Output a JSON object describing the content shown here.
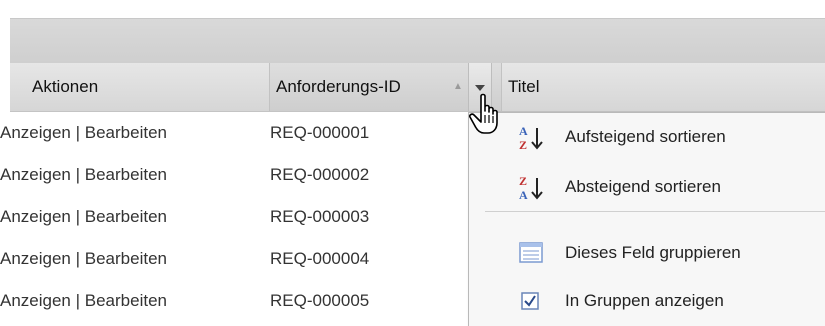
{
  "table": {
    "columns": [
      {
        "label": "Aktionen"
      },
      {
        "label": "Anforderungs-ID"
      },
      {
        "label": "Titel"
      }
    ],
    "rows": [
      {
        "actions": "Anzeigen | Bearbeiten",
        "view": "Anzeigen",
        "edit": "Bearbeiten",
        "id": "REQ-000001"
      },
      {
        "actions": "Anzeigen | Bearbeiten",
        "view": "Anzeigen",
        "edit": "Bearbeiten",
        "id": "REQ-000002"
      },
      {
        "actions": "Anzeigen | Bearbeiten",
        "view": "Anzeigen",
        "edit": "Bearbeiten",
        "id": "REQ-000003"
      },
      {
        "actions": "Anzeigen | Bearbeiten",
        "view": "Anzeigen",
        "edit": "Bearbeiten",
        "id": "REQ-000004"
      },
      {
        "actions": "Anzeigen | Bearbeiten",
        "view": "Anzeigen",
        "edit": "Bearbeiten",
        "id": "REQ-000005"
      }
    ]
  },
  "menu": {
    "items": [
      {
        "label": "Aufsteigend sortieren",
        "icon": "sort-ascending-icon"
      },
      {
        "label": "Absteigend sortieren",
        "icon": "sort-descending-icon"
      },
      {
        "label": "Dieses Feld gruppieren",
        "icon": "group-field-icon"
      },
      {
        "label": "In Gruppen anzeigen",
        "icon": "checkbox-checked-icon",
        "checked": true
      }
    ]
  },
  "colors": {
    "header_bg": "#dcdcdc",
    "menu_bg": "#f7f7f7",
    "az_blue": "#3a63b8",
    "az_red": "#c03030"
  }
}
